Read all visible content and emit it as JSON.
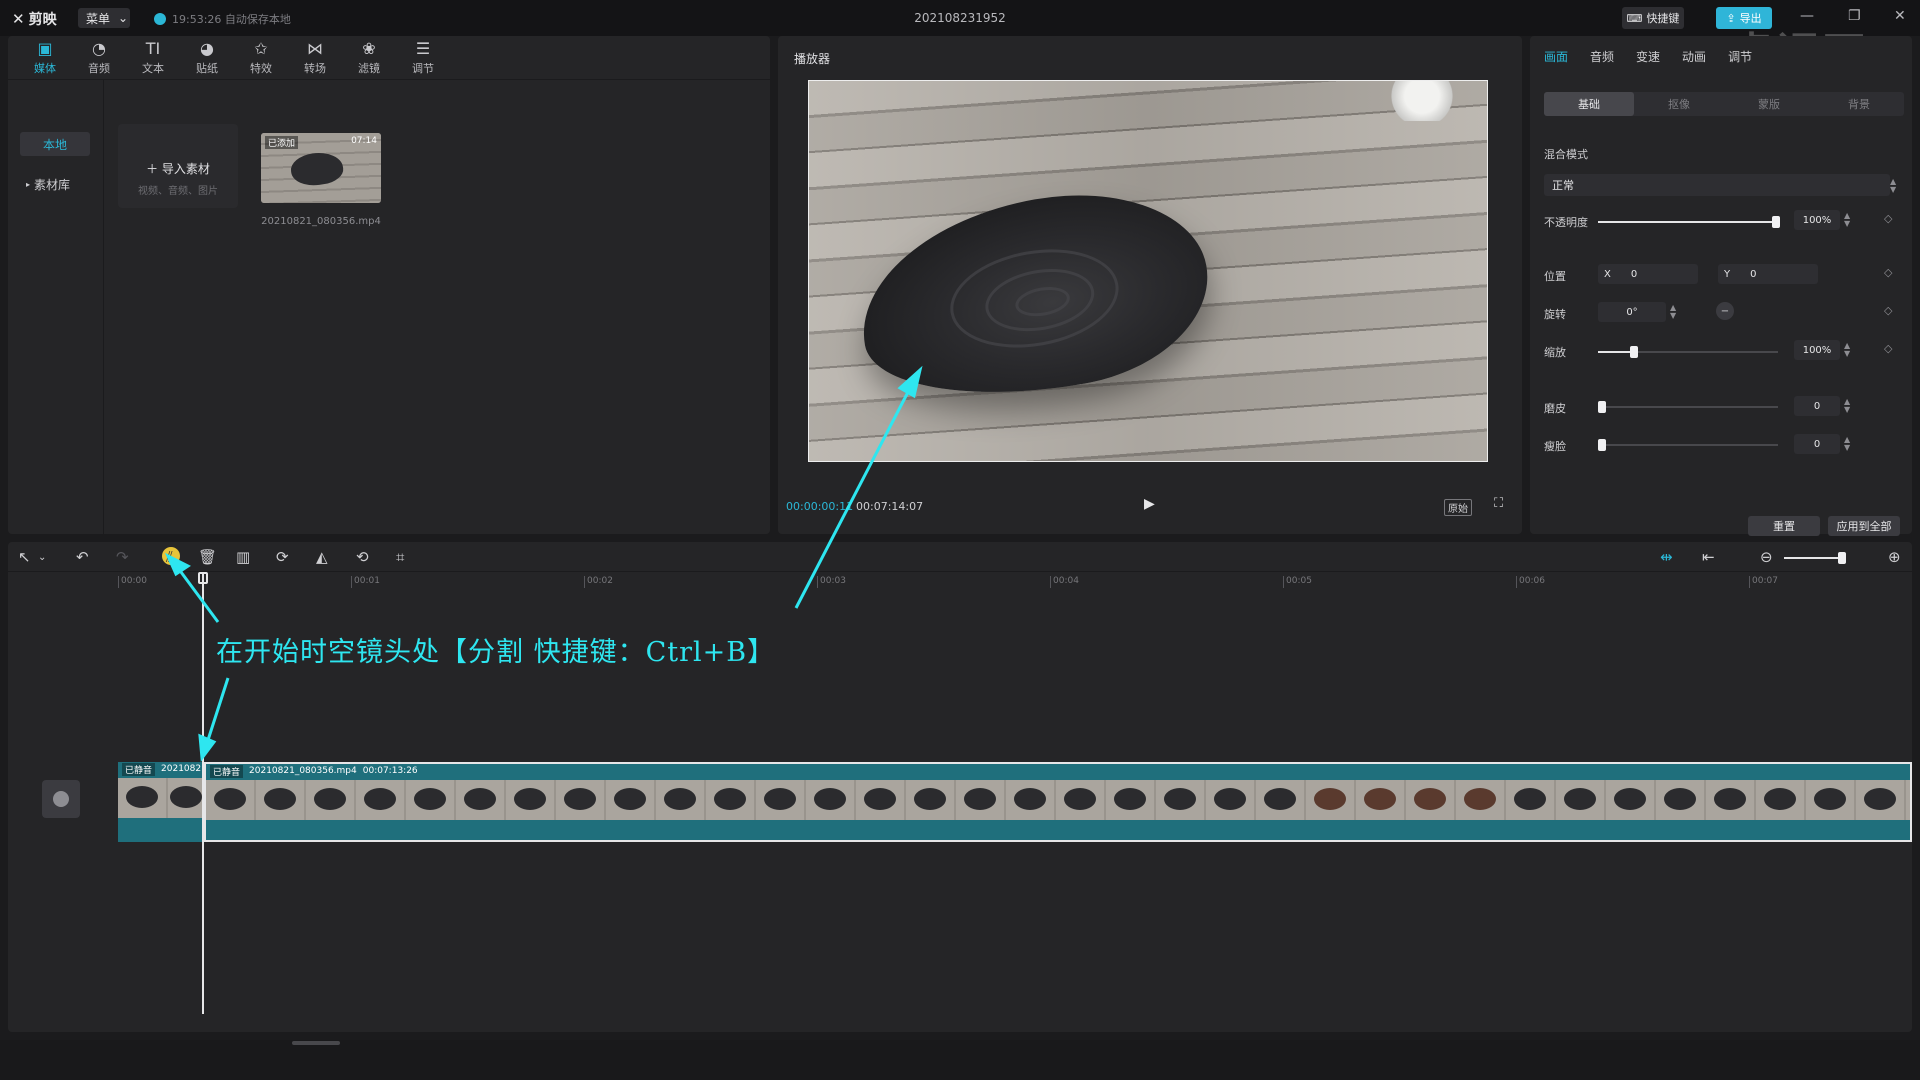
{
  "titlebar": {
    "app_name": "剪映",
    "menu_label": "菜单",
    "autosave": "19:53:26 自动保存本地",
    "project_title": "202108231952",
    "shortcut_label": "快捷键",
    "export_label": "导出",
    "watermark": "虎课网"
  },
  "media": {
    "tabs": [
      {
        "label": "媒体",
        "icon": "media-icon"
      },
      {
        "label": "音频",
        "icon": "audio-icon"
      },
      {
        "label": "文本",
        "icon": "text-icon"
      },
      {
        "label": "贴纸",
        "icon": "sticker-icon"
      },
      {
        "label": "特效",
        "icon": "effects-icon"
      },
      {
        "label": "转场",
        "icon": "transition-icon"
      },
      {
        "label": "滤镜",
        "icon": "filter-icon"
      },
      {
        "label": "调节",
        "icon": "adjust-icon"
      }
    ],
    "side_local": "本地",
    "side_library": "素材库",
    "import_label": "导入素材",
    "import_sub": "视频、音频、图片",
    "thumb_tag": "已添加",
    "thumb_duration": "07:14",
    "thumb_name": "20210821_080356.mp4"
  },
  "player": {
    "title": "播放器",
    "time_current": "00:00:00:11",
    "time_total": "00:07:14:07",
    "original_label": "原始"
  },
  "properties": {
    "tabs": [
      "画面",
      "音频",
      "变速",
      "动画",
      "调节"
    ],
    "subtabs": [
      "基础",
      "抠像",
      "蒙版",
      "背景"
    ],
    "blend_label": "混合模式",
    "blend_value": "正常",
    "opacity_label": "不透明度",
    "opacity_value": "100%",
    "position_label": "位置",
    "pos_x_label": "X",
    "pos_x": "0",
    "pos_y_label": "Y",
    "pos_y": "0",
    "rotate_label": "旋转",
    "rotate_value": "0°",
    "scale_label": "缩放",
    "scale_value": "100%",
    "smooth_label": "磨皮",
    "smooth_value": "0",
    "slim_label": "瘦脸",
    "slim_value": "0",
    "reset_label": "重置",
    "apply_all_label": "应用到全部"
  },
  "timeline": {
    "ruler": [
      "00:00",
      "00:01",
      "00:02",
      "00:03",
      "00:04",
      "00:05",
      "00:06",
      "00:07"
    ],
    "clip1_mute": "已静音",
    "clip1_name": "2021082",
    "clip2_mute": "已静音",
    "clip2_name": "20210821_080356.mp4",
    "clip2_duration": "00:07:13:26"
  },
  "annotation": {
    "text": "在开始时空镜头处【分割 快捷键：Ctrl+B】"
  },
  "colors": {
    "accent": "#2bb7d6",
    "annotation": "#2ee6f0",
    "clip": "#1f6f7c",
    "split_highlight": "#e8c43a"
  }
}
